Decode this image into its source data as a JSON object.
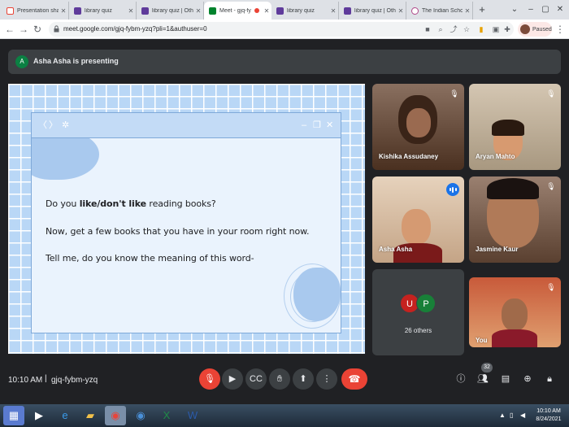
{
  "browser": {
    "tabs": [
      {
        "title": "Presentation sha",
        "favicon_color": "#ea4335"
      },
      {
        "title": "library quiz",
        "favicon_color": "#5f3b9b"
      },
      {
        "title": "library quiz | Othe",
        "favicon_color": "#5f3b9b"
      },
      {
        "title": "Meet - gjq-fy",
        "favicon_color": "#00832d",
        "active": true
      },
      {
        "title": "library quiz",
        "favicon_color": "#5f3b9b"
      },
      {
        "title": "library quiz | Othe",
        "favicon_color": "#5f3b9b"
      },
      {
        "title": "The Indian Schoo",
        "favicon_color": "#b04a8a"
      }
    ],
    "url": "meet.google.com/gjq-fybm-yzq?pli=1&authuser=0",
    "profile_label": "Paused"
  },
  "meet": {
    "presenter_initial": "A",
    "presenting_text": "Asha Asha is presenting",
    "slide": {
      "line1_pre": "Do you ",
      "line1_bold": "like/don't like",
      "line1_post": " reading books?",
      "line2": "Now, get a few books that you have in your room right now.",
      "line3": "Tell me, do you know the meaning of this word-"
    },
    "participants": [
      {
        "name": "Kishika Assudaney",
        "bg": "#6b4a3a"
      },
      {
        "name": "Aryan Mahto",
        "bg": "#c9b9a4"
      },
      {
        "name": "Asha Asha",
        "bg": "#d8b89c"
      },
      {
        "name": "Jasmine Kaur",
        "bg": "#8a6a55"
      },
      {
        "name": "You",
        "bg": "#b75a3a"
      }
    ],
    "others": {
      "avatars": [
        {
          "letter": "U",
          "color": "#c5221f"
        },
        {
          "letter": "P",
          "color": "#188038"
        }
      ],
      "label": "26 others"
    },
    "time": "10:10 AM",
    "separator": "|",
    "meeting_code": "gjq-fybm-yzq",
    "participant_count": "32"
  },
  "taskbar": {
    "time": "10:10 AM",
    "date": "8/24/2021"
  }
}
